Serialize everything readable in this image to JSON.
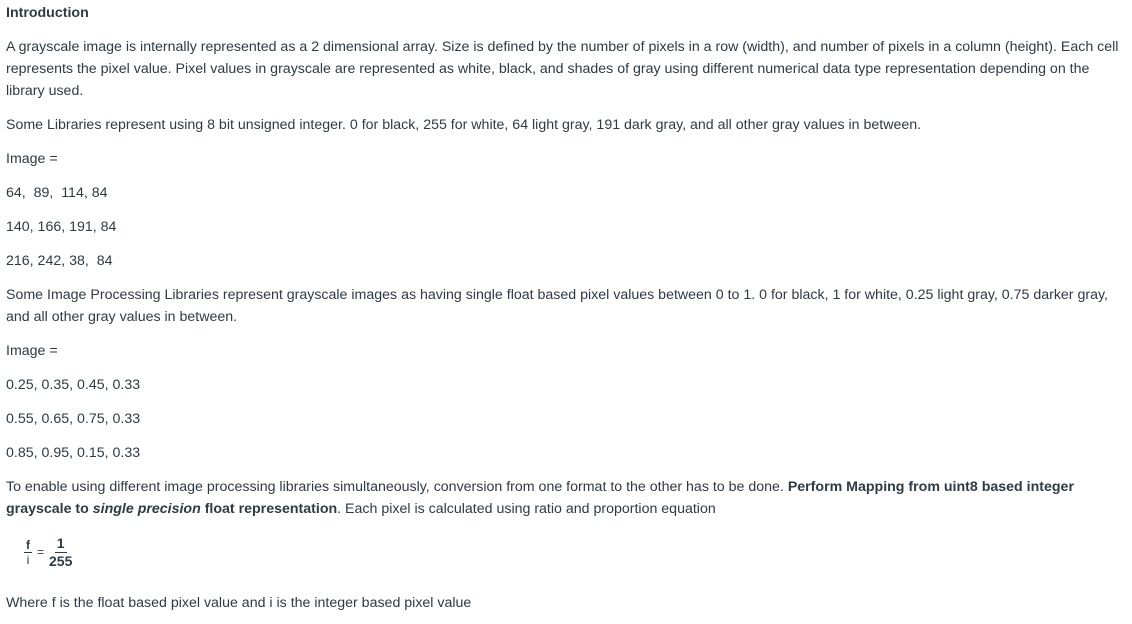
{
  "title": "Introduction",
  "p1": "A grayscale image is internally represented as a 2 dimensional array. Size is defined by the number of pixels in a row (width), and number of pixels in a column (height). Each cell represents the pixel value. Pixel values in grayscale are represented as white, black, and shades of gray using different numerical data type representation depending on the library used.",
  "p2": "Some Libraries represent using 8 bit unsigned integer. 0 for black, 255 for white, 64 light gray, 191 dark gray, and all other gray values in between.",
  "image_label": "Image =",
  "uint8_rows": [
    "64,  89,  114, 84",
    "140, 166, 191, 84",
    "216, 242, 38,  84"
  ],
  "p3": "Some Image Processing Libraries represent grayscale images as having single float based pixel values between 0 to 1. 0 for black, 1 for white, 0.25 light gray, 0.75 darker gray, and all other gray values in between.",
  "float_rows": [
    "0.25, 0.35, 0.45, 0.33",
    "0.55, 0.65, 0.75, 0.33",
    "0.85, 0.95, 0.15, 0.33"
  ],
  "p4": {
    "a": "To enable using different image processing libraries simultaneously, conversion from one format to the other has to be done. ",
    "b": "Perform Mapping from uint8 based integer grayscale to ",
    "c": "single precision",
    "d": " float representation",
    "e": ". Each pixel is calculated using ratio and proportion equation"
  },
  "equation": {
    "left_num": "f",
    "left_den": "i",
    "eq": "=",
    "right_num": "1",
    "right_den": "255"
  },
  "p5": "Where f is the float based pixel value and i is the integer based pixel value"
}
